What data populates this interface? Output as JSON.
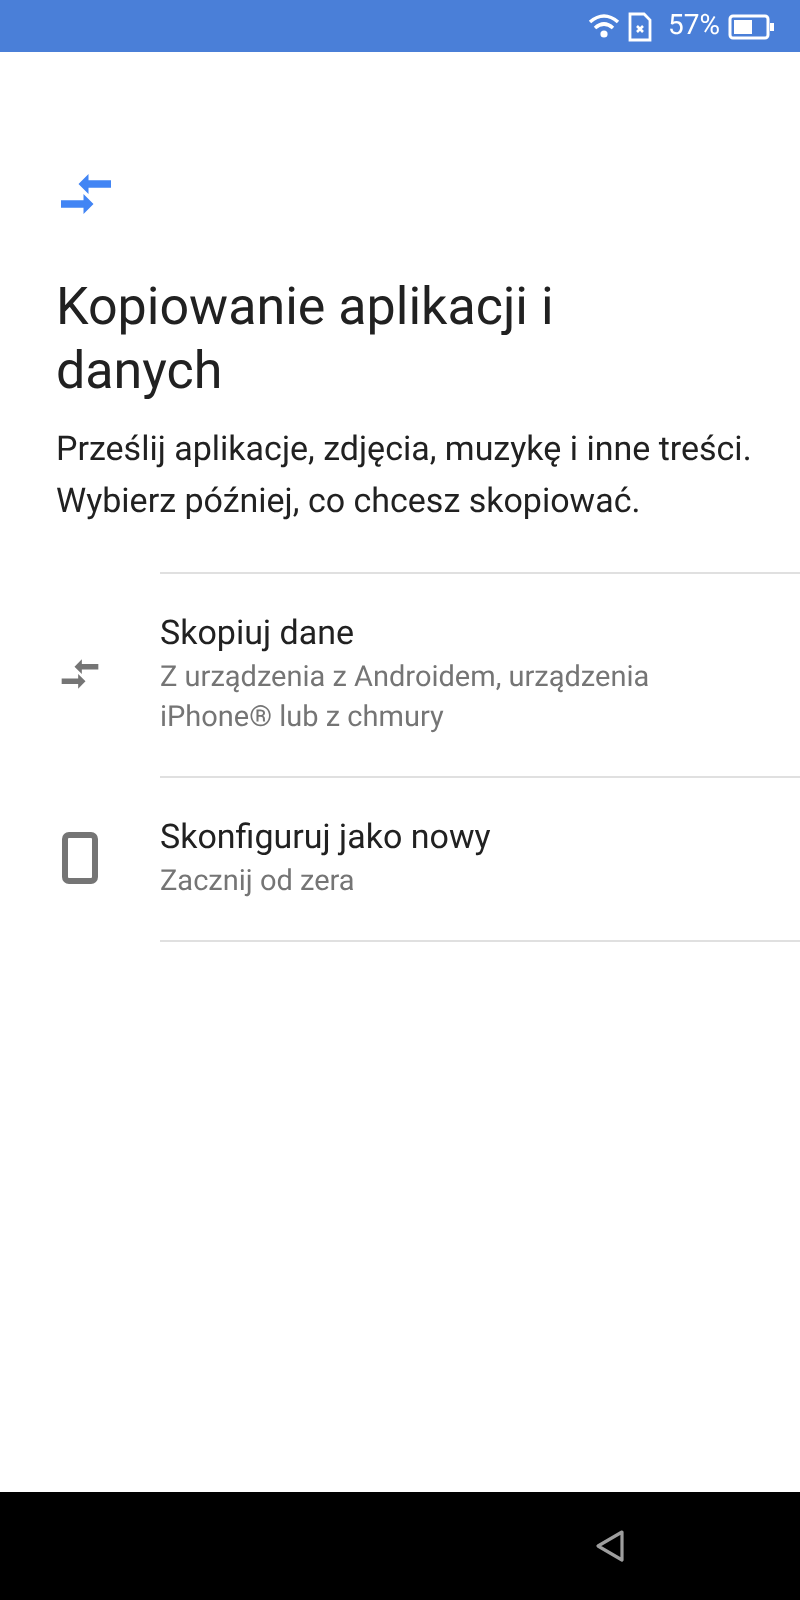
{
  "status_bar": {
    "battery_percent": "57%"
  },
  "title": "Kopiowanie aplikacji i danych",
  "description": "Prześlij aplikacje, zdjęcia, muzykę i inne treści. Wybierz później, co chcesz skopiować.",
  "options": [
    {
      "kind": "copy",
      "title": "Skopiuj dane",
      "subtitle": "Z urządzenia z Androidem, urządzenia iPhone® lub z chmury"
    },
    {
      "kind": "phone",
      "title": "Skonfiguruj jako nowy",
      "subtitle": "Zacznij od zera"
    }
  ]
}
